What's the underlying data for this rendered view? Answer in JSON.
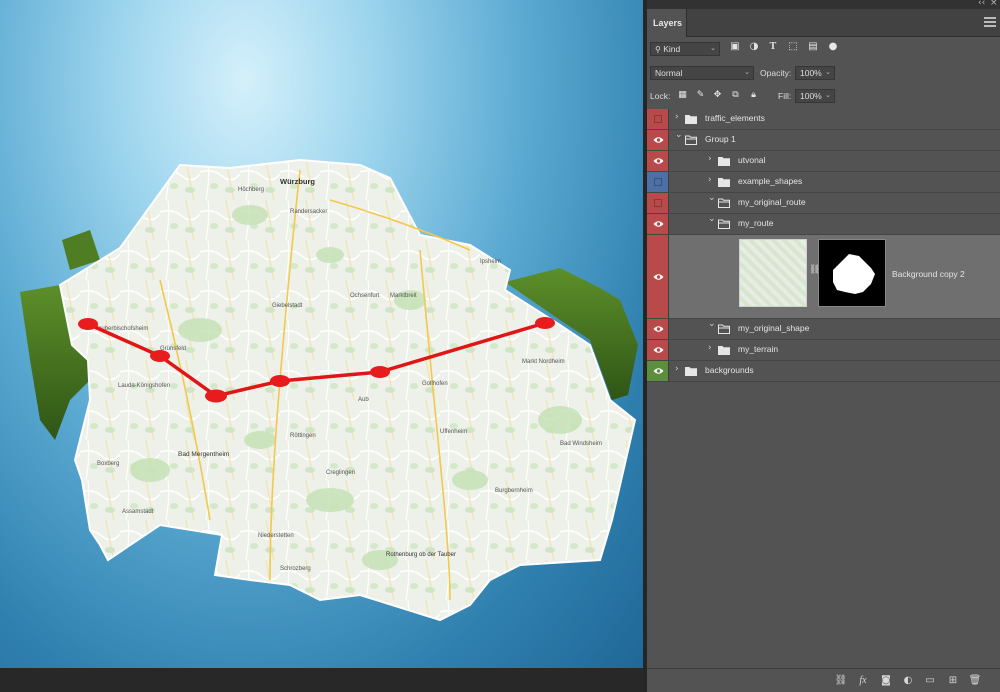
{
  "panel": {
    "tab_label": "Layers",
    "topbar_collapse_glyph": "‹‹",
    "topbar_close_glyph": "×"
  },
  "filter": {
    "kind_label": "Kind",
    "icons": [
      "image-filter-icon",
      "adjustment-filter-icon",
      "type-filter-icon",
      "shape-filter-icon",
      "smart-object-filter-icon",
      "filter-toggle-icon"
    ]
  },
  "blend": {
    "mode": "Normal",
    "opacity_label": "Opacity:",
    "opacity_value": "100%"
  },
  "lock": {
    "label": "Lock:",
    "icons": [
      "lock-transparent-icon",
      "lock-paint-icon",
      "lock-position-icon",
      "lock-artboard-icon",
      "lock-all-icon"
    ],
    "fill_label": "Fill:",
    "fill_value": "100%"
  },
  "layers": [
    {
      "name": "traffic_elements",
      "indent": 0,
      "visible": false,
      "color": "#b84a4a",
      "expanded": false
    },
    {
      "name": "Group 1",
      "indent": 0,
      "visible": true,
      "color": "#b84a4a",
      "expanded": true
    },
    {
      "name": "utvonal",
      "indent": 1,
      "visible": true,
      "color": "#b84a4a",
      "expanded": false
    },
    {
      "name": "example_shapes",
      "indent": 1,
      "visible": false,
      "color": "#4c6fa6",
      "expanded": false
    },
    {
      "name": "my_original_route",
      "indent": 1,
      "visible": false,
      "color": "#b84a4a",
      "expanded": true
    },
    {
      "name": "my_route",
      "indent": 1,
      "visible": true,
      "color": "#b84a4a",
      "expanded": true
    },
    {
      "name": "Background copy 2",
      "indent": 2,
      "visible": true,
      "color": "#b84a4a",
      "selected": true,
      "is_image": true
    },
    {
      "name": "my_original_shape",
      "indent": 1,
      "visible": true,
      "color": "#b84a4a",
      "expanded": true
    },
    {
      "name": "my_terrain",
      "indent": 1,
      "visible": true,
      "color": "#b84a4a",
      "expanded": false
    },
    {
      "name": "backgrounds",
      "indent": 0,
      "visible": true,
      "color": "#5c8e3e",
      "expanded": false
    }
  ],
  "bottom_icons": [
    "link-layers-icon",
    "fx-icon",
    "add-mask-icon",
    "new-adjustment-icon",
    "new-group-icon",
    "new-layer-icon",
    "delete-icon"
  ],
  "bottom_fx_label": "fx",
  "map": {
    "route_color": "#e01515",
    "labels": [
      {
        "text": "Würzburg"
      },
      {
        "text": "Höchberg"
      },
      {
        "text": "Randersacker"
      },
      {
        "text": "Giebelstadt"
      },
      {
        "text": "Ochsenfurt"
      },
      {
        "text": "Marktbreit"
      },
      {
        "text": "Tauberbischofsheim"
      },
      {
        "text": "Grünsfeld"
      },
      {
        "text": "Lauda-Königshofen"
      },
      {
        "text": "Bad Mergentheim"
      },
      {
        "text": "Röttingen"
      },
      {
        "text": "Creglingen"
      },
      {
        "text": "Aub"
      },
      {
        "text": "Uffenheim"
      },
      {
        "text": "Markt Nordheim"
      },
      {
        "text": "Rothenburg ob der Tauber"
      },
      {
        "text": "Niederstetten"
      },
      {
        "text": "Boxberg"
      },
      {
        "text": "Assamstadt"
      },
      {
        "text": "Burgbernheim"
      },
      {
        "text": "Bad Windsheim"
      },
      {
        "text": "Gollhofen"
      },
      {
        "text": "Ipsheim"
      },
      {
        "text": "Schrozberg"
      }
    ]
  }
}
